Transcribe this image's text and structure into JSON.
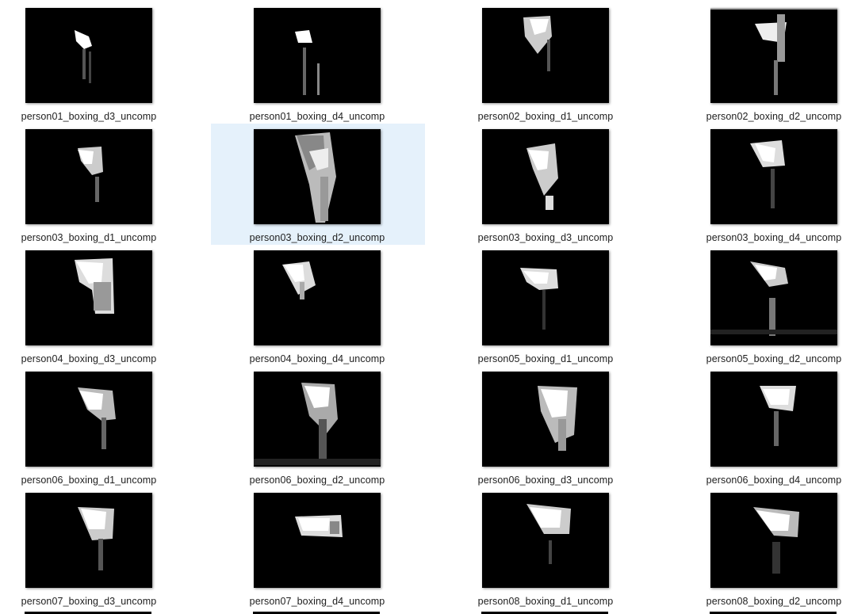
{
  "files": [
    {
      "name": "person01_boxing_d3_uncomp",
      "selected": false
    },
    {
      "name": "person01_boxing_d4_uncomp",
      "selected": false
    },
    {
      "name": "person02_boxing_d1_uncomp",
      "selected": false
    },
    {
      "name": "person02_boxing_d2_uncomp",
      "selected": false
    },
    {
      "name": "person03_boxing_d1_uncomp",
      "selected": false
    },
    {
      "name": "person03_boxing_d2_uncomp",
      "selected": true
    },
    {
      "name": "person03_boxing_d3_uncomp",
      "selected": false
    },
    {
      "name": "person03_boxing_d4_uncomp",
      "selected": false
    },
    {
      "name": "person04_boxing_d3_uncomp",
      "selected": false
    },
    {
      "name": "person04_boxing_d4_uncomp",
      "selected": false
    },
    {
      "name": "person05_boxing_d1_uncomp",
      "selected": false
    },
    {
      "name": "person05_boxing_d2_uncomp",
      "selected": false
    },
    {
      "name": "person06_boxing_d1_uncomp",
      "selected": false
    },
    {
      "name": "person06_boxing_d2_uncomp",
      "selected": false
    },
    {
      "name": "person06_boxing_d3_uncomp",
      "selected": false
    },
    {
      "name": "person06_boxing_d4_uncomp",
      "selected": false
    },
    {
      "name": "person07_boxing_d3_uncomp",
      "selected": false
    },
    {
      "name": "person07_boxing_d4_uncomp",
      "selected": false
    },
    {
      "name": "person08_boxing_d1_uncomp",
      "selected": false
    },
    {
      "name": "person08_boxing_d2_uncomp",
      "selected": false
    }
  ]
}
